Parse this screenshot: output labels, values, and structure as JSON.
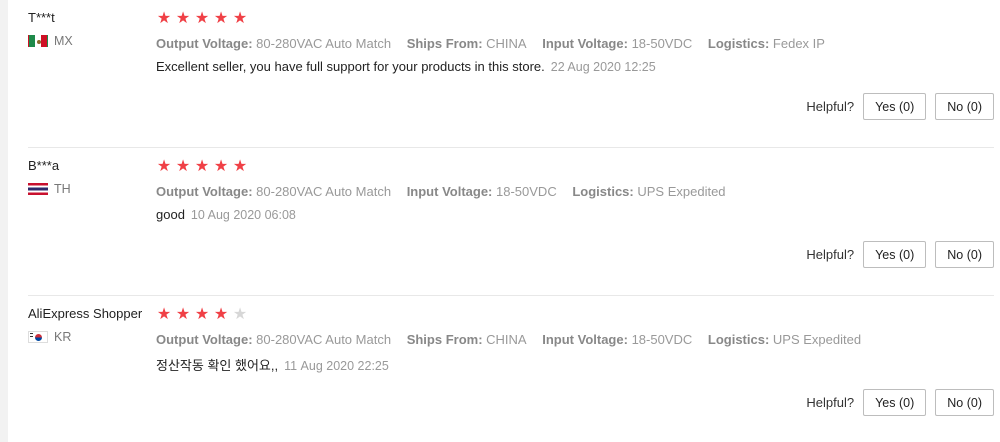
{
  "helpful_label": "Helpful?",
  "reviews": [
    {
      "user": "T***t",
      "country": "MX",
      "rating": 5,
      "stars_label": "★★★★★",
      "attributes": [
        {
          "key": "Output Voltage:",
          "value": "80-280VAC Auto Match"
        },
        {
          "key": "Ships From:",
          "value": "CHINA"
        },
        {
          "key": "Input Voltage:",
          "value": "18-50VDC"
        },
        {
          "key": "Logistics:",
          "value": "Fedex IP"
        }
      ],
      "text": "Excellent seller, you have full support for your products in this store.",
      "date": "22 Aug 2020 12:25",
      "yes_label": "Yes (0)",
      "no_label": "No (0)"
    },
    {
      "user": "B***a",
      "country": "TH",
      "rating": 5,
      "attributes": [
        {
          "key": "Output Voltage:",
          "value": "80-280VAC Auto Match"
        },
        {
          "key": "Input Voltage:",
          "value": "18-50VDC"
        },
        {
          "key": "Logistics:",
          "value": "UPS Expedited"
        }
      ],
      "text": "good",
      "date": "10 Aug 2020 06:08",
      "yes_label": "Yes (0)",
      "no_label": "No (0)"
    },
    {
      "user": "AliExpress Shopper",
      "country": "KR",
      "rating": 4,
      "attributes": [
        {
          "key": "Output Voltage:",
          "value": "80-280VAC Auto Match"
        },
        {
          "key": "Ships From:",
          "value": "CHINA"
        },
        {
          "key": "Input Voltage:",
          "value": "18-50VDC"
        },
        {
          "key": "Logistics:",
          "value": "UPS Expedited"
        }
      ],
      "text": "정산작동 확인 했어요,,",
      "date": "11 Aug 2020 22:25",
      "yes_label": "Yes (0)",
      "no_label": "No (0)"
    }
  ],
  "colors": {
    "star_filled": "#f04046",
    "star_empty": "#d7d7d7",
    "muted_text": "#999999",
    "divider": "#e8e8e8"
  },
  "icons": {
    "star": "star-icon",
    "flags": [
      "mexico-flag-icon",
      "thailand-flag-icon",
      "south-korea-flag-icon"
    ]
  }
}
